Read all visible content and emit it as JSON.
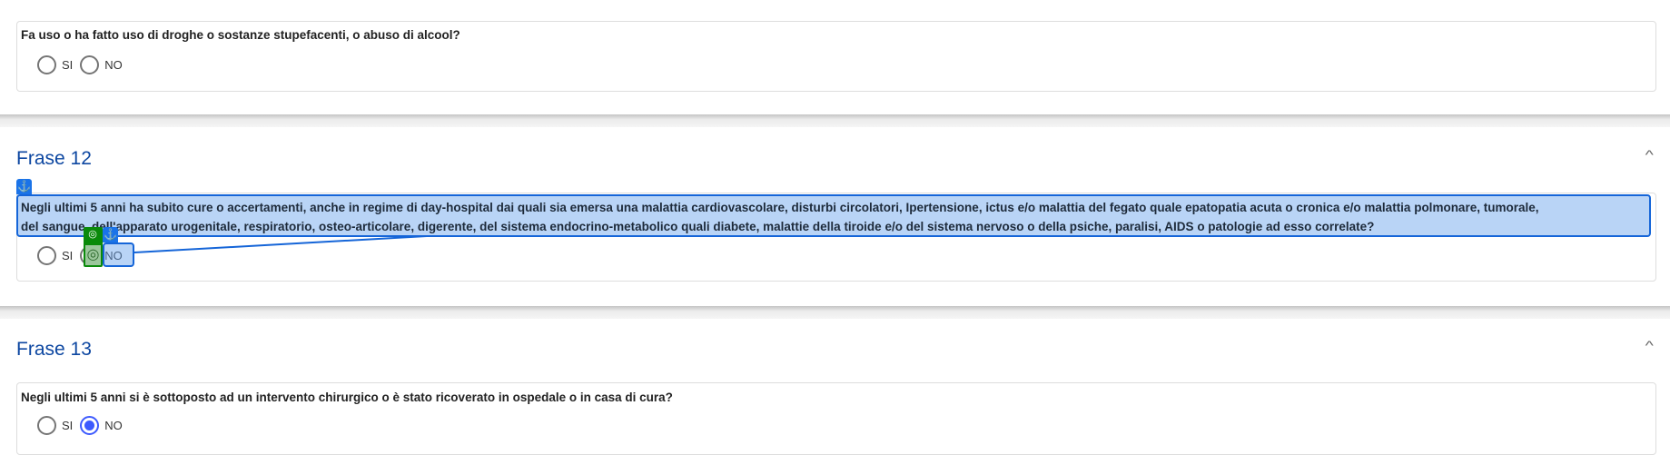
{
  "sections": [
    {
      "title": null,
      "question": "Fa uso o ha fatto uso di droghe o sostanze stupefacenti, o abuso di alcool?",
      "options": [
        "SI",
        "NO"
      ],
      "selected": null
    },
    {
      "title": "Frase 12",
      "question_line1": "Negli ultimi 5 anni ha subito cure o accertamenti, anche in regime di day-hospital dai quali sia emersa una malattia cardiovascolare, disturbi circolatori, Ipertensione, ictus e/o malattia del fegato quale epatopatia acuta o cronica e/o malattia polmonare, tumorale,",
      "question_line2": "del sangue, dell'apparato urogenitale, respiratorio, osteo-articolare, digerente, del sistema endocrino-metabolico quali diabete, malattie della tiroide e/o del sistema nervoso o della psiche, paralisi, AIDS o patologie ad esso correlate?",
      "options": [
        "SI",
        "NO"
      ],
      "selected": null
    },
    {
      "title": "Frase 13",
      "question": "Negli ultimi 5 anni si è sottoposto ad un intervento chirurgico o è stato ricoverato in ospedale o in casa di cura?",
      "options": [
        "SI",
        "NO"
      ],
      "selected": "NO"
    }
  ],
  "icons": {
    "collapse": "chevron-up-icon",
    "anchor": "anchor-icon",
    "target": "target-icon"
  },
  "colors": {
    "title": "#0d47a1",
    "highlight": "#1565d8",
    "target": "#0a8a0a",
    "radio_selected": "#3d5afe"
  }
}
